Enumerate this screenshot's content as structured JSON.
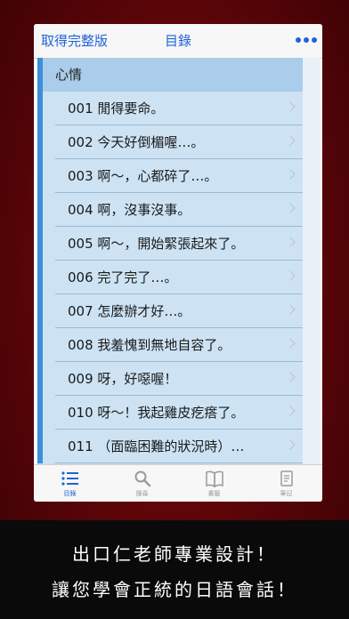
{
  "nav": {
    "left_label": "取得完整版",
    "title": "目錄",
    "more_icon": "more-dots-icon"
  },
  "section": {
    "title": "心情"
  },
  "rows": [
    {
      "label": "001 閒得要命。"
    },
    {
      "label": "002 今天好倒楣喔…。"
    },
    {
      "label": "003 啊～，心都碎了…。"
    },
    {
      "label": "004 啊，沒事沒事。"
    },
    {
      "label": "005 啊～，開始緊張起來了。"
    },
    {
      "label": "006 完了完了…。"
    },
    {
      "label": "007 怎麼辦才好…。"
    },
    {
      "label": "008 我羞愧到無地自容了。"
    },
    {
      "label": "009 呀，好噁喔！"
    },
    {
      "label": "010 呀～！我起雞皮疙瘩了。"
    },
    {
      "label": "011 （面臨困難的狀況時）…"
    }
  ],
  "tabs": [
    {
      "label": "目錄",
      "icon": "list-icon",
      "active": true
    },
    {
      "label": "搜尋",
      "icon": "search-icon",
      "active": false
    },
    {
      "label": "書籤",
      "icon": "book-icon",
      "active": false
    },
    {
      "label": "筆記",
      "icon": "notes-icon",
      "active": false
    }
  ],
  "caption": {
    "line1": "出口仁老師專業設計！",
    "line2": "讓您學會正統的日語會話！"
  },
  "colors": {
    "accent": "#1f63d8",
    "row_bg": "#cde3f4",
    "header_bg": "#a9cdea",
    "stripe": "#3d8fd6"
  }
}
